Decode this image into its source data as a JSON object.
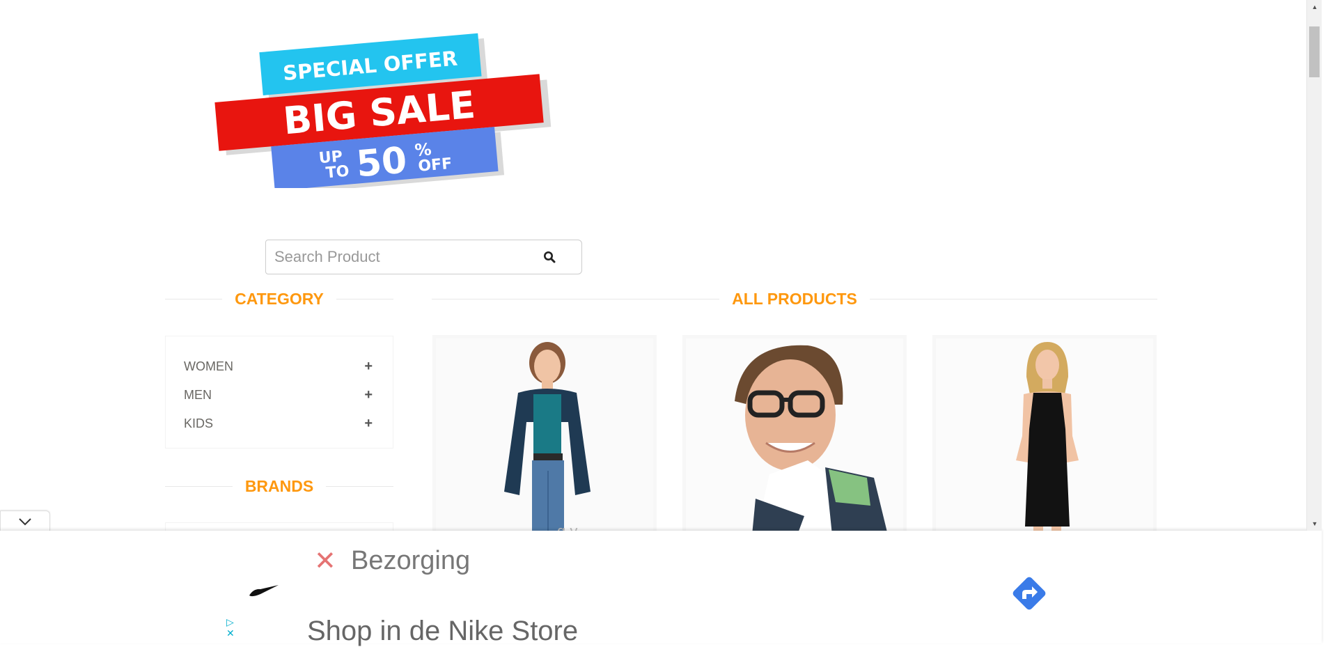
{
  "banner": {
    "line1": "SPECIAL OFFER",
    "line2": "BIG SALE",
    "line3_up": "UP",
    "line3_to": "TO",
    "line3_pct": "50",
    "line3_sym": "%",
    "line3_off": "OFF"
  },
  "search": {
    "placeholder": "Search Product",
    "button_icon": "search-icon"
  },
  "category": {
    "title": "CATEGORY",
    "items": [
      {
        "label": "WOMEN",
        "toggle": "+"
      },
      {
        "label": "MEN",
        "toggle": "+"
      },
      {
        "label": "KIDS",
        "toggle": "+"
      }
    ]
  },
  "brands": {
    "title": "BRANDS"
  },
  "products": {
    "title": "ALL PRODUCTS"
  },
  "ad": {
    "headline": "Bezorging",
    "subline": "Shop in de Nike Store",
    "close_icon": "close-icon",
    "brand_logo": "nike-swoosh-logo",
    "go_icon": "directions-arrow-icon",
    "adchoices_icon": "adchoices-icon"
  },
  "colors": {
    "accent": "#fe980f",
    "text": "#696763",
    "banner_blue_light": "#23c4ef",
    "banner_red": "#e8150f",
    "banner_blue": "#5a83e8",
    "ad_go": "#3a7be8"
  }
}
